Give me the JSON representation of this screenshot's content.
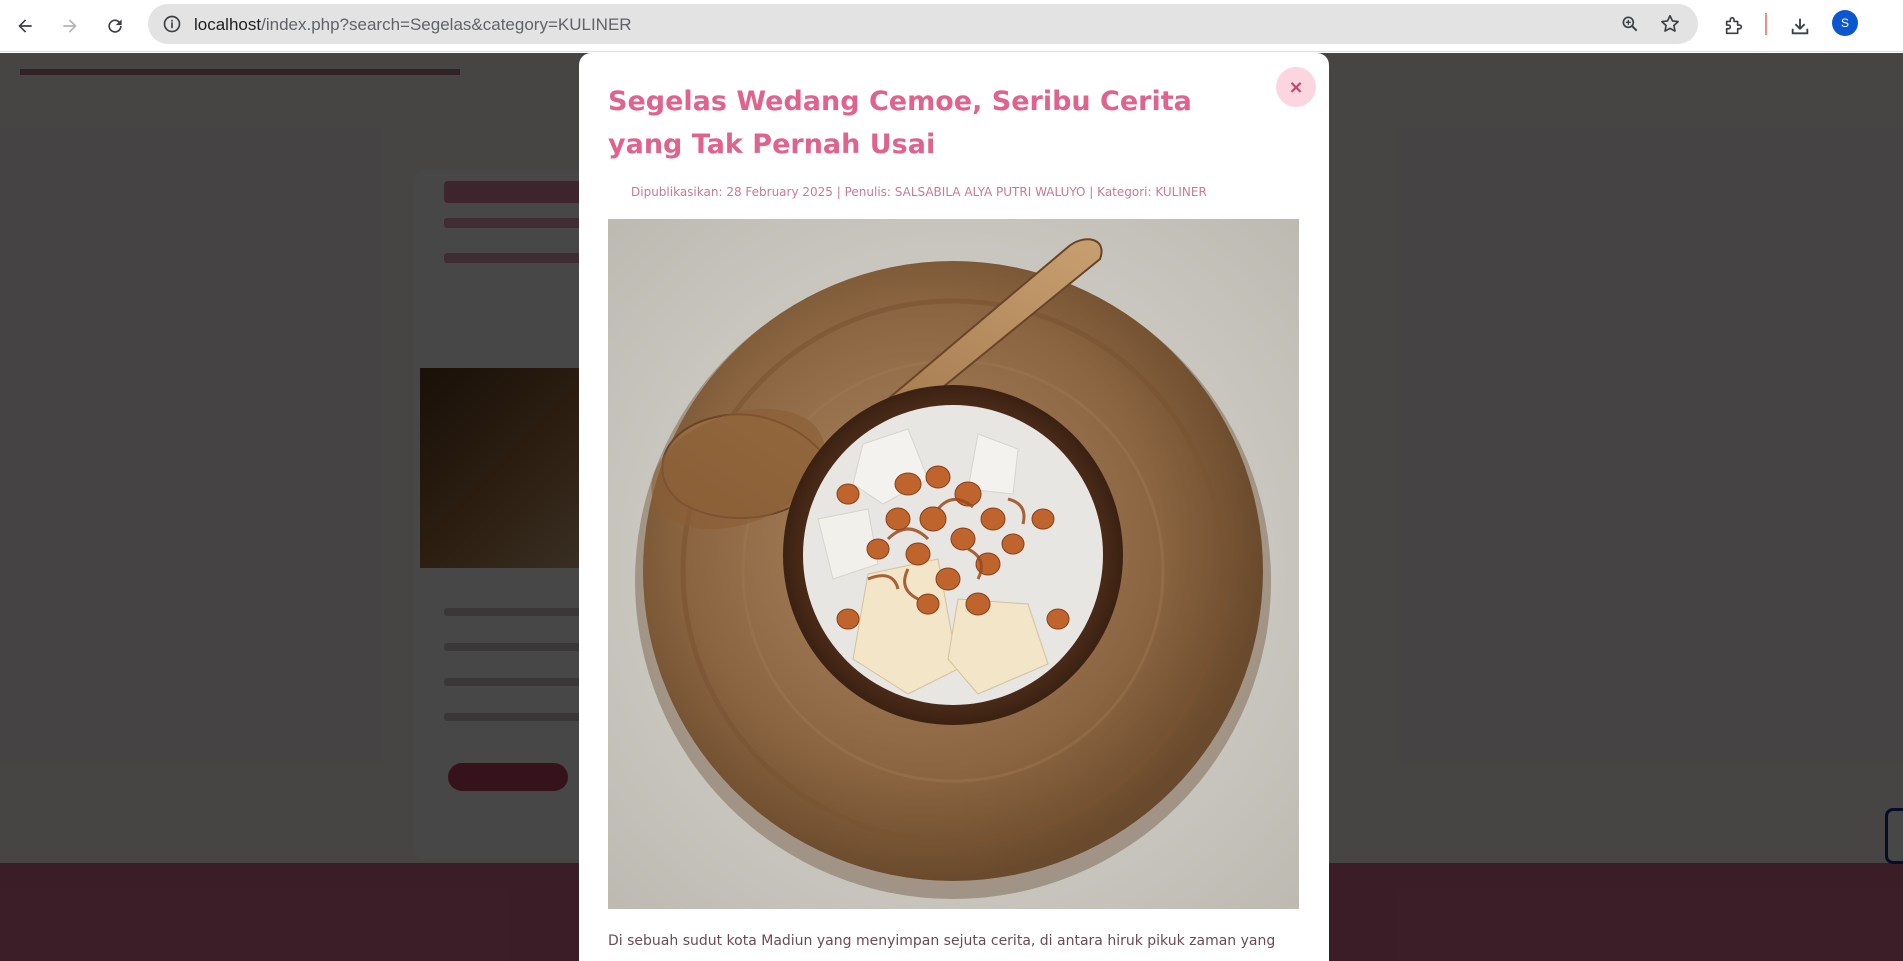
{
  "browser": {
    "url_host": "localhost",
    "url_path": "/index.php?search=Segelas&category=KULINER",
    "avatar_initial": "S",
    "icons": [
      "back-icon",
      "forward-icon",
      "reload-icon",
      "site-info-icon",
      "zoom-icon",
      "bookmark-star-icon",
      "extensions-icon",
      "downloads-icon"
    ]
  },
  "modal": {
    "close_label": "×",
    "title": "Segelas Wedang Cemoe, Seribu Cerita yang Tak Pernah Usai",
    "meta": "Dipublikasikan: 28 February 2025 | Penulis: SALSABILA ALYA PUTRI WALUYO | Kategori: KULINER",
    "body_first_line": "Di sebuah sudut kota Madiun yang menyimpan sejuta cerita, di antara hiruk pikuk zaman yang"
  },
  "colors": {
    "accent": "#e0638d",
    "meta_text": "#c97a95",
    "close_bg": "#fbd5df",
    "avatar_bg": "#0b57d0"
  }
}
